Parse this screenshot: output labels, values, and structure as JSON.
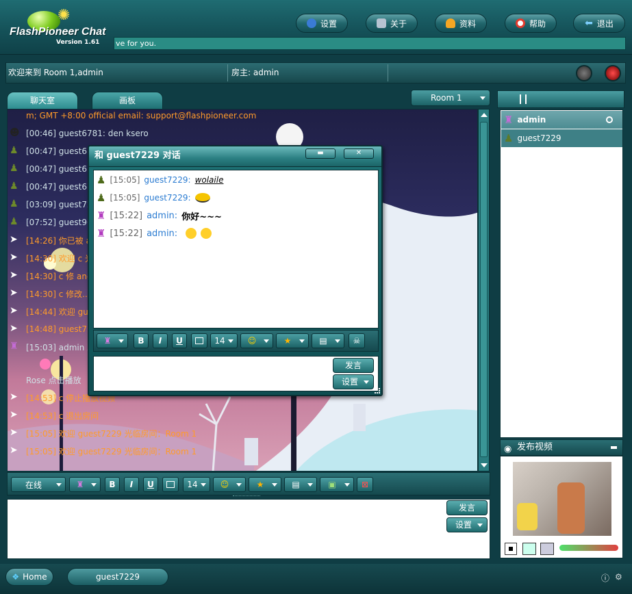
{
  "app": {
    "logo_text": "FlashPioneer Chat",
    "version": "Version 1.61",
    "ticker": "ve for you."
  },
  "top_buttons": [
    {
      "label": "设置",
      "icon": "gear-icon",
      "color": "#3a7bd5"
    },
    {
      "label": "关于",
      "icon": "edit-icon",
      "color": "#b6c3d1"
    },
    {
      "label": "资料",
      "icon": "profile-icon",
      "color": "#f5a623"
    },
    {
      "label": "帮助",
      "icon": "lifebuoy-icon",
      "color": "#e23b2e"
    },
    {
      "label": "退出",
      "icon": "exit-arrow-icon",
      "color": "#3aa0e0"
    }
  ],
  "status": {
    "welcome": "欢迎来到 Room 1,admin",
    "owner": "房主: admin"
  },
  "tabs": [
    "聊天室",
    "画板"
  ],
  "room_select": "Room 1",
  "chat_messages": [
    {
      "avatar": "",
      "text": "m; GMT +8:00 official email: support@flashpioneer.com",
      "style": "orange"
    },
    {
      "avatar": "cat",
      "text": "[00:46] guest6781: den ksero",
      "style": "plain"
    },
    {
      "avatar": "guest",
      "text": "[00:47] guest67",
      "style": "plain"
    },
    {
      "avatar": "guest",
      "text": "[00:47] guest67",
      "style": "plain"
    },
    {
      "avatar": "guest",
      "text": "[00:47] guest67",
      "style": "plain"
    },
    {
      "avatar": "guest",
      "text": "[03:09] guest72",
      "style": "plain"
    },
    {
      "avatar": "guest",
      "text": "[07:52] guest96",
      "style": "plain"
    },
    {
      "avatar": "arrow",
      "text": "[14:26] 你已被 a",
      "style": "orange"
    },
    {
      "avatar": "arrow",
      "text": "[14:30] 欢迎 c 光",
      "style": "orange"
    },
    {
      "avatar": "arrow",
      "text": "[14:30] c 修 anc",
      "style": "orange"
    },
    {
      "avatar": "arrow",
      "text": "[14:30] c 修改...",
      "style": "orange"
    },
    {
      "avatar": "arrow",
      "text": "[14:44] 欢迎 gue",
      "style": "orange"
    },
    {
      "avatar": "arrow",
      "text": "[14:48] guest73",
      "style": "orange"
    },
    {
      "avatar": "admin",
      "text": "[15:03] admin 发",
      "style": "plain"
    },
    {
      "avatar": "",
      "text": "",
      "style": "plain"
    },
    {
      "avatar": "",
      "text": "Rose 点击播放",
      "style": "plain"
    },
    {
      "avatar": "arrow",
      "text": "[14:53] c 停止播放视频",
      "style": "orange"
    },
    {
      "avatar": "arrow",
      "text": "[14:53] c 退出房间",
      "style": "orange"
    },
    {
      "avatar": "arrow",
      "text": "[15:05] 欢迎 guest7229 光临房间：Room 1",
      "style": "orange"
    },
    {
      "avatar": "arrow",
      "text": "[15:05] 欢迎 guest7229 光临房间：Room 1",
      "style": "orange"
    }
  ],
  "toolbar": {
    "status_select": "在线",
    "bold": "B",
    "italic": "I",
    "underline": "U",
    "font_size": "14"
  },
  "input": {
    "send_label": "发言",
    "settings_label": "设置"
  },
  "bottom": {
    "home_label": "Home",
    "user_label": "guest7229"
  },
  "userlist": {
    "users": [
      {
        "name": "admin",
        "avatar": "admin",
        "selected_style": "header"
      },
      {
        "name": "guest7229",
        "avatar": "guest",
        "selected_style": "selected"
      }
    ]
  },
  "video": {
    "title": "发布视频"
  },
  "dialog": {
    "title": "和  guest7229  对话",
    "messages": [
      {
        "avatar": "guest",
        "time": "[15:05]",
        "name": "guest7229:",
        "text": "wolaile",
        "style": "italic-underline"
      },
      {
        "avatar": "guest",
        "time": "[15:05]",
        "name": "guest7229:",
        "text": "",
        "style": "emoji"
      },
      {
        "avatar": "admin",
        "time": "[15:22]",
        "name": "admin:",
        "text": "你好~~~",
        "style": "bold-big"
      },
      {
        "avatar": "admin",
        "time": "[15:22]",
        "name": "admin:",
        "text": "",
        "style": "emojis"
      }
    ],
    "toolbar": {
      "bold": "B",
      "italic": "I",
      "underline": "U",
      "font_size": "14"
    },
    "send_label": "发言",
    "settings_label": "设置"
  }
}
